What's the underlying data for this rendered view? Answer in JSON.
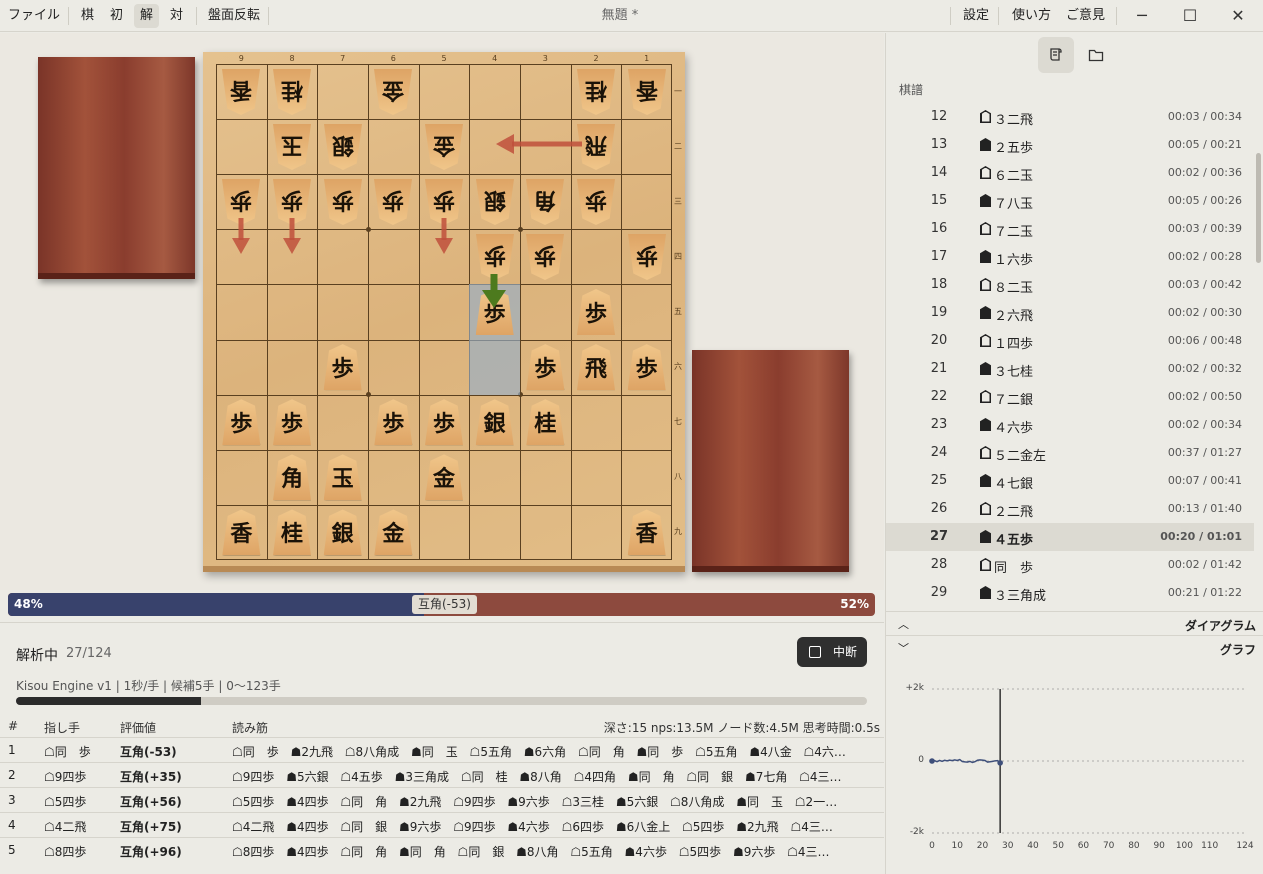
{
  "menu": {
    "file": "ファイル",
    "mode_kifu": "棋",
    "mode_init": "初",
    "mode_analyze": "解",
    "mode_versus": "対",
    "flip": "盤面反転",
    "settings": "設定",
    "usage": "使い方",
    "feedback": "ご意見"
  },
  "window": {
    "title": "無題 *",
    "minimize_icon": "─",
    "maximize_icon": "☐",
    "close_icon": "✕"
  },
  "board": {
    "file_labels": [
      "9",
      "8",
      "7",
      "6",
      "5",
      "4",
      "3",
      "2",
      "1"
    ],
    "rank_labels": [
      "一",
      "二",
      "三",
      "四",
      "五",
      "六",
      "七",
      "八",
      "九"
    ],
    "pieces": [
      {
        "file": 9,
        "rank": 1,
        "char": "香",
        "owner": "gote"
      },
      {
        "file": 8,
        "rank": 1,
        "char": "桂",
        "owner": "gote"
      },
      {
        "file": 6,
        "rank": 1,
        "char": "金",
        "owner": "gote"
      },
      {
        "file": 2,
        "rank": 1,
        "char": "桂",
        "owner": "gote"
      },
      {
        "file": 1,
        "rank": 1,
        "char": "香",
        "owner": "gote"
      },
      {
        "file": 8,
        "rank": 2,
        "char": "玉",
        "owner": "gote"
      },
      {
        "file": 7,
        "rank": 2,
        "char": "銀",
        "owner": "gote"
      },
      {
        "file": 5,
        "rank": 2,
        "char": "金",
        "owner": "gote"
      },
      {
        "file": 2,
        "rank": 2,
        "char": "飛",
        "owner": "gote"
      },
      {
        "file": 9,
        "rank": 3,
        "char": "歩",
        "owner": "gote"
      },
      {
        "file": 8,
        "rank": 3,
        "char": "歩",
        "owner": "gote"
      },
      {
        "file": 7,
        "rank": 3,
        "char": "歩",
        "owner": "gote"
      },
      {
        "file": 6,
        "rank": 3,
        "char": "歩",
        "owner": "gote"
      },
      {
        "file": 5,
        "rank": 3,
        "char": "歩",
        "owner": "gote"
      },
      {
        "file": 4,
        "rank": 3,
        "char": "銀",
        "owner": "gote"
      },
      {
        "file": 3,
        "rank": 3,
        "char": "角",
        "owner": "gote"
      },
      {
        "file": 2,
        "rank": 3,
        "char": "歩",
        "owner": "gote"
      },
      {
        "file": 4,
        "rank": 4,
        "char": "歩",
        "owner": "gote"
      },
      {
        "file": 3,
        "rank": 4,
        "char": "歩",
        "owner": "gote"
      },
      {
        "file": 1,
        "rank": 4,
        "char": "歩",
        "owner": "gote"
      },
      {
        "file": 4,
        "rank": 5,
        "char": "歩",
        "owner": "sente"
      },
      {
        "file": 2,
        "rank": 5,
        "char": "歩",
        "owner": "sente"
      },
      {
        "file": 7,
        "rank": 6,
        "char": "歩",
        "owner": "sente"
      },
      {
        "file": 3,
        "rank": 6,
        "char": "歩",
        "owner": "sente"
      },
      {
        "file": 2,
        "rank": 6,
        "char": "飛",
        "owner": "sente"
      },
      {
        "file": 1,
        "rank": 6,
        "char": "歩",
        "owner": "sente"
      },
      {
        "file": 9,
        "rank": 7,
        "char": "歩",
        "owner": "sente"
      },
      {
        "file": 8,
        "rank": 7,
        "char": "歩",
        "owner": "sente"
      },
      {
        "file": 6,
        "rank": 7,
        "char": "歩",
        "owner": "sente"
      },
      {
        "file": 5,
        "rank": 7,
        "char": "歩",
        "owner": "sente"
      },
      {
        "file": 4,
        "rank": 7,
        "char": "銀",
        "owner": "sente"
      },
      {
        "file": 3,
        "rank": 7,
        "char": "桂",
        "owner": "sente"
      },
      {
        "file": 8,
        "rank": 8,
        "char": "角",
        "owner": "sente"
      },
      {
        "file": 7,
        "rank": 8,
        "char": "玉",
        "owner": "sente"
      },
      {
        "file": 5,
        "rank": 8,
        "char": "金",
        "owner": "sente"
      },
      {
        "file": 9,
        "rank": 9,
        "char": "香",
        "owner": "sente"
      },
      {
        "file": 8,
        "rank": 9,
        "char": "桂",
        "owner": "sente"
      },
      {
        "file": 7,
        "rank": 9,
        "char": "銀",
        "owner": "sente"
      },
      {
        "file": 6,
        "rank": 9,
        "char": "金",
        "owner": "sente"
      },
      {
        "file": 1,
        "rank": 9,
        "char": "香",
        "owner": "sente"
      }
    ],
    "highlight_squares": [
      {
        "file": 4,
        "rank": 5
      },
      {
        "file": 4,
        "rank": 6
      }
    ],
    "colors": {
      "hint_arrow": "#c0503c",
      "best_arrow": "#4d7a1e"
    }
  },
  "eval_bar": {
    "sente_pct": 48,
    "left_label": "48%",
    "right_label": "52%",
    "center_label": "互角(-53)",
    "colors": {
      "sente": "#38426c",
      "gote": "#8d4a3e"
    }
  },
  "analysis": {
    "status": "解析中",
    "count": "27/124",
    "stop_label": "中断",
    "engine_info": "Kisou Engine v1 | 1秒/手 | 候補5手 | 0〜123手",
    "progress": 0.217,
    "headers": {
      "num": "#",
      "move": "指し手",
      "eval": "評価値",
      "pv": "読み筋"
    },
    "stats": "深さ:15 nps:13.5M ノード数:4.5M 思考時間:0.5s",
    "rows": [
      {
        "n": "1",
        "move": "☖同　歩",
        "eval": "互角(-53)",
        "pv": "☖同　歩 ☗2九飛 ☖8八角成 ☗同　玉 ☖5五角 ☗6六角 ☖同　角 ☗同　歩 ☖5五角 ☗4八金 ☖4六…"
      },
      {
        "n": "2",
        "move": "☖9四歩",
        "eval": "互角(+35)",
        "pv": "☖9四歩 ☗5六銀 ☖4五歩 ☗3三角成 ☖同　桂 ☗8八角 ☖4四角 ☗同　角 ☖同　銀 ☗7七角 ☖4三…"
      },
      {
        "n": "3",
        "move": "☖5四歩",
        "eval": "互角(+56)",
        "pv": "☖5四歩 ☗4四歩 ☖同　角 ☗2九飛 ☖9四歩 ☗9六歩 ☖3三桂 ☗5六銀 ☖8八角成 ☗同　玉 ☖2一…"
      },
      {
        "n": "4",
        "move": "☖4二飛",
        "eval": "互角(+75)",
        "pv": "☖4二飛 ☗4四歩 ☖同　銀 ☗9六歩 ☖9四歩 ☗4六歩 ☖6四歩 ☗6八金上 ☖5四歩 ☗2九飛 ☖4三…"
      },
      {
        "n": "5",
        "move": "☖8四歩",
        "eval": "互角(+96)",
        "pv": "☖8四歩 ☗4四歩 ☖同　角 ☗同　角 ☖同　銀 ☗8八角 ☖5五角 ☗4六歩 ☖5四歩 ☗9六歩 ☖4三…"
      }
    ]
  },
  "sidebar": {
    "tab_kifu_icon": "scroll-icon",
    "tab_folder_icon": "folder-icon",
    "kifu_label": "棋譜",
    "moves": [
      {
        "no": "12",
        "side": "w",
        "text": "３二飛",
        "time": "00:03 / 00:34"
      },
      {
        "no": "13",
        "side": "b",
        "text": "２五歩",
        "time": "00:05 / 00:21"
      },
      {
        "no": "14",
        "side": "w",
        "text": "６二玉",
        "time": "00:02 / 00:36"
      },
      {
        "no": "15",
        "side": "b",
        "text": "７八玉",
        "time": "00:05 / 00:26"
      },
      {
        "no": "16",
        "side": "w",
        "text": "７二玉",
        "time": "00:03 / 00:39"
      },
      {
        "no": "17",
        "side": "b",
        "text": "１六歩",
        "time": "00:02 / 00:28"
      },
      {
        "no": "18",
        "side": "w",
        "text": "８二玉",
        "time": "00:03 / 00:42"
      },
      {
        "no": "19",
        "side": "b",
        "text": "２六飛",
        "time": "00:02 / 00:30"
      },
      {
        "no": "20",
        "side": "w",
        "text": "１四歩",
        "time": "00:06 / 00:48"
      },
      {
        "no": "21",
        "side": "b",
        "text": "３七桂",
        "time": "00:02 / 00:32"
      },
      {
        "no": "22",
        "side": "w",
        "text": "７二銀",
        "time": "00:02 / 00:50"
      },
      {
        "no": "23",
        "side": "b",
        "text": "４六歩",
        "time": "00:02 / 00:34"
      },
      {
        "no": "24",
        "side": "w",
        "text": "５二金左",
        "time": "00:37 / 01:27"
      },
      {
        "no": "25",
        "side": "b",
        "text": "４七銀",
        "time": "00:07 / 00:41"
      },
      {
        "no": "26",
        "side": "w",
        "text": "２二飛",
        "time": "00:13 / 01:40"
      },
      {
        "no": "27",
        "side": "b",
        "text": "４五歩",
        "time": "00:20 / 01:01",
        "selected": true
      },
      {
        "no": "28",
        "side": "w",
        "text": "同　歩",
        "time": "00:02 / 01:42"
      },
      {
        "no": "29",
        "side": "b",
        "text": "３三角成",
        "time": "00:21 / 01:22"
      }
    ],
    "diagram_label": "ダイアグラム",
    "graph_label": "グラフ"
  },
  "chart_data": {
    "type": "line",
    "title": "",
    "xlabel": "",
    "ylabel": "",
    "xlim": [
      0,
      124
    ],
    "ylim": [
      -2000,
      2000
    ],
    "x_ticks": [
      "0",
      "10",
      "20",
      "30",
      "40",
      "50",
      "60",
      "70",
      "80",
      "90",
      "100",
      "110",
      "124"
    ],
    "y_ticks": [
      "+2k",
      "0",
      "-2k"
    ],
    "current_move": 27,
    "series": [
      {
        "x": [
          0,
          1,
          2,
          3,
          4,
          5,
          6,
          7,
          8,
          9,
          10,
          11,
          12,
          13,
          14,
          15,
          16,
          17,
          18,
          19,
          20,
          21,
          22,
          23,
          24,
          25,
          26,
          27
        ],
        "y": [
          0,
          10,
          -20,
          15,
          -10,
          20,
          5,
          25,
          10,
          30,
          15,
          40,
          -15,
          -25,
          -30,
          -10,
          -40,
          -20,
          20,
          30,
          25,
          15,
          -30,
          -20,
          -10,
          5,
          10,
          -53
        ],
        "color": "#3e4f7a"
      }
    ]
  }
}
